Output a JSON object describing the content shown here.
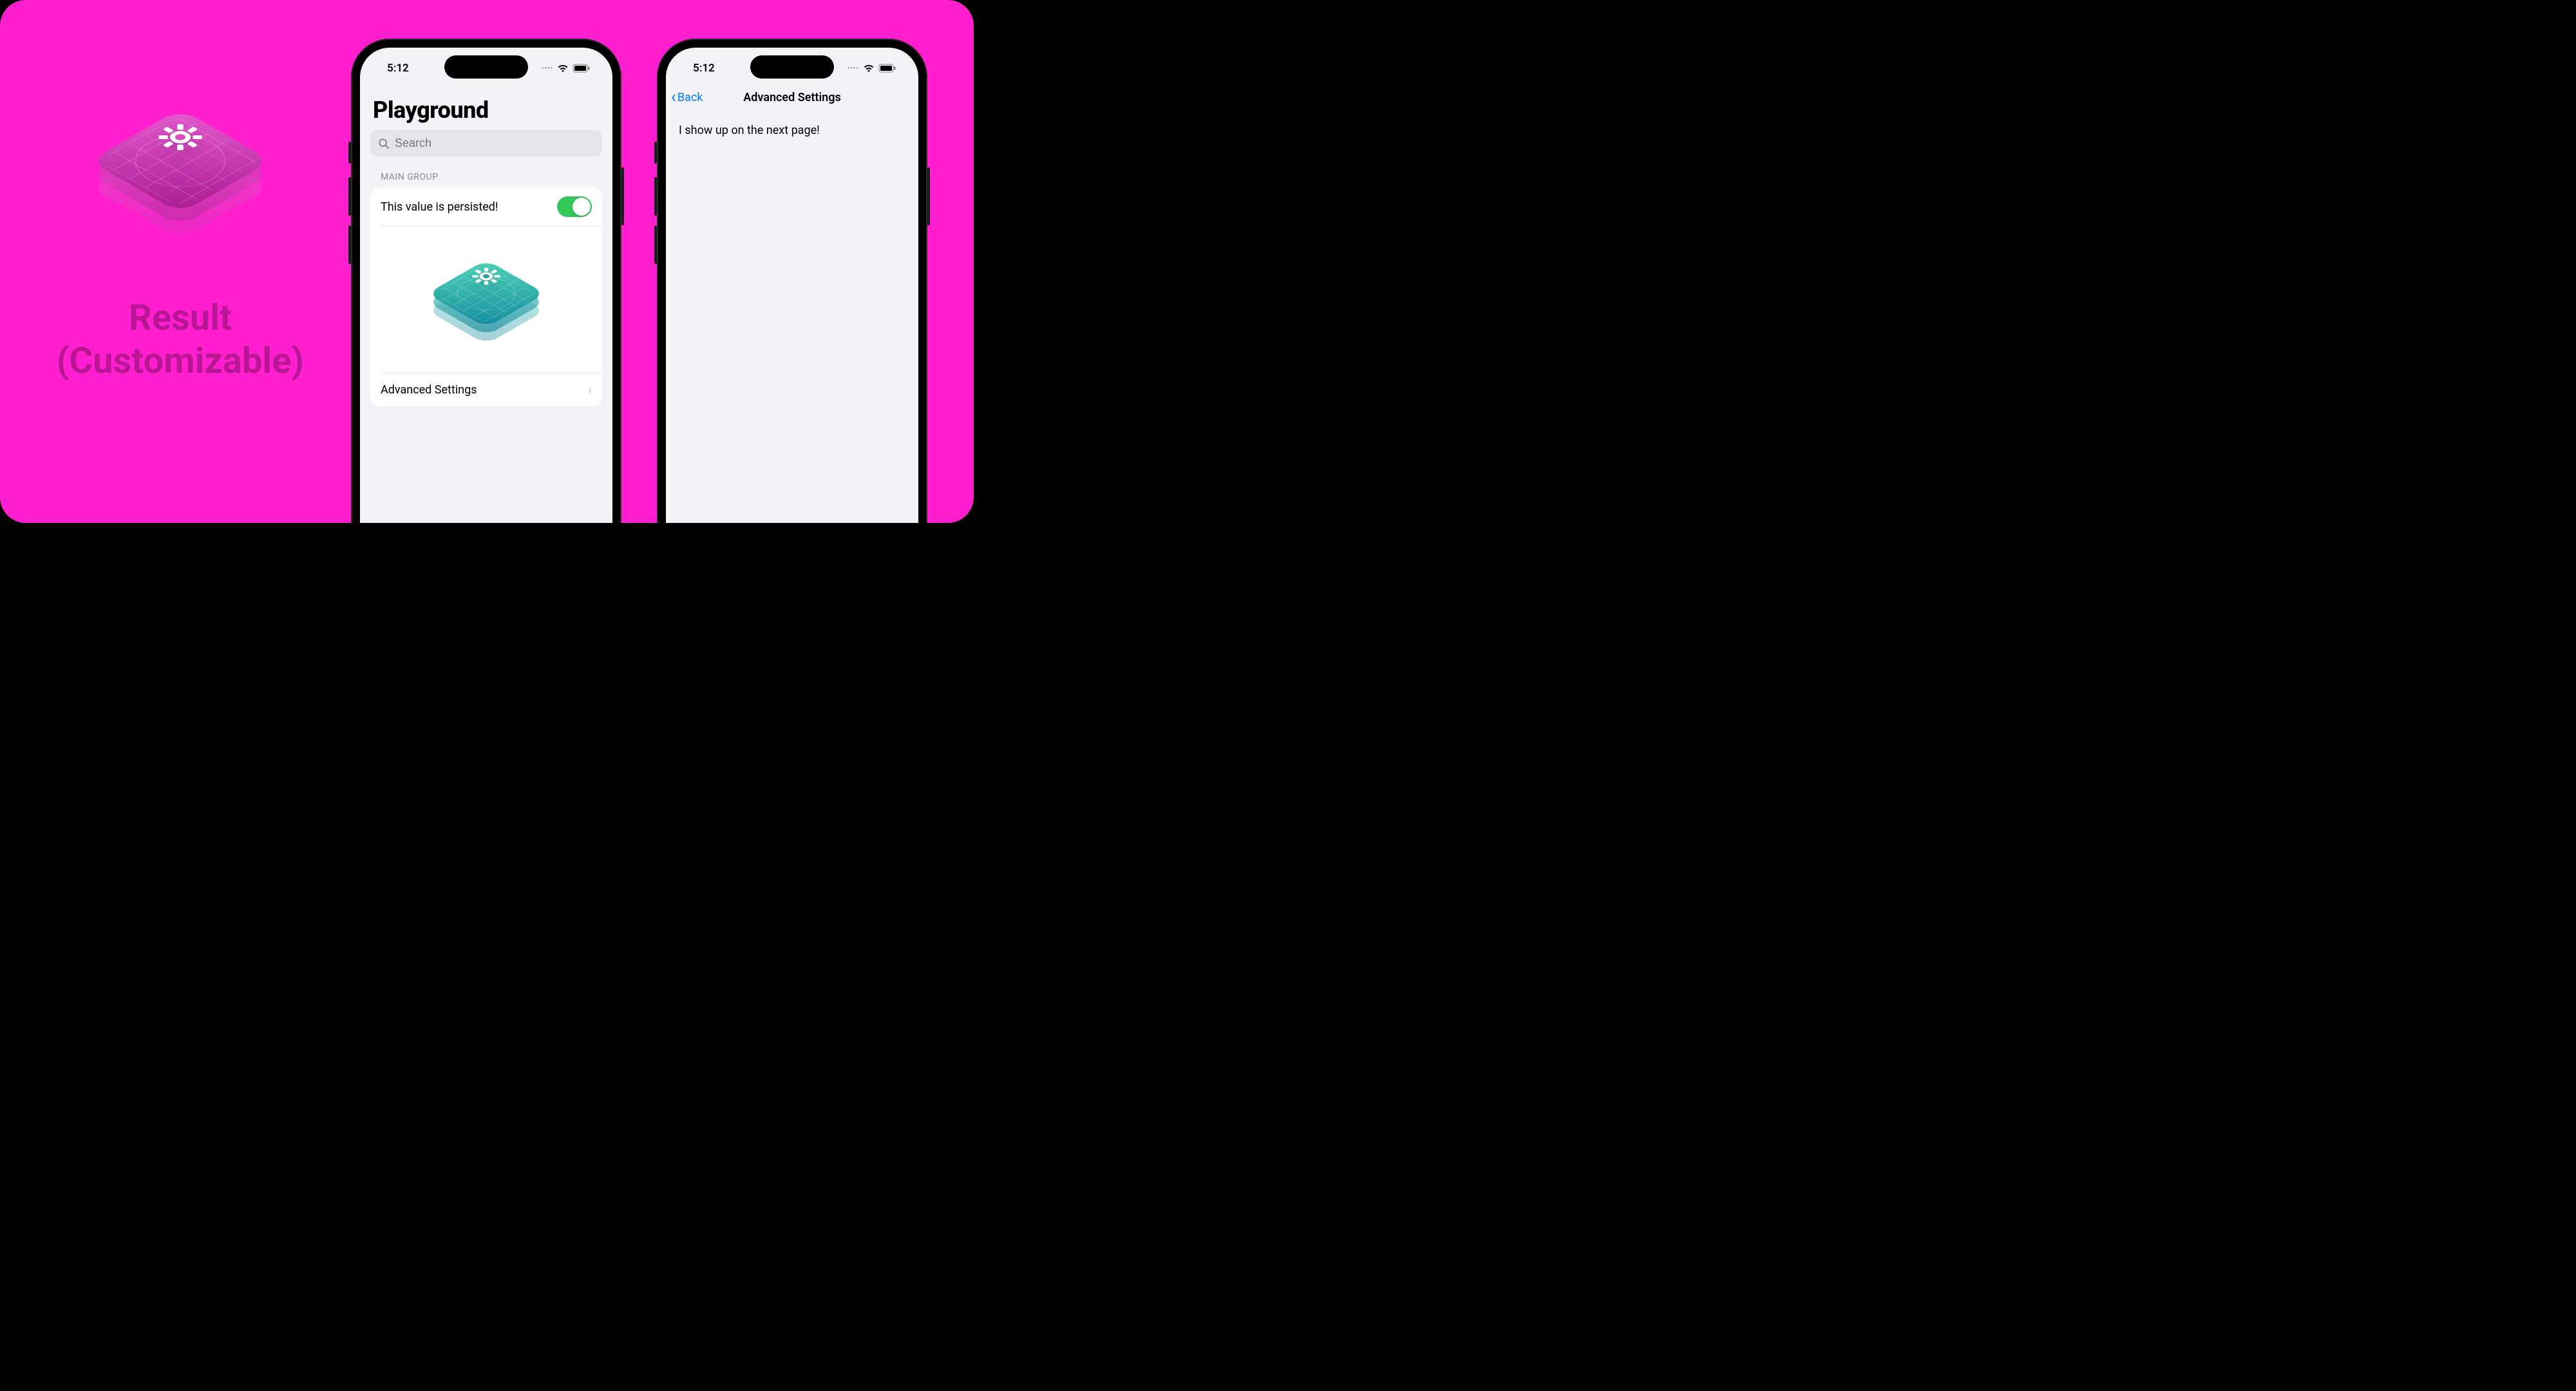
{
  "promo": {
    "line1": "Result",
    "line2": "(Customizable)"
  },
  "status": {
    "time": "5:12"
  },
  "phone1": {
    "title": "Playground",
    "search_placeholder": "Search",
    "section_header": "MAIN GROUP",
    "toggle_label": "This value is persisted!",
    "toggle_on": true,
    "advanced_label": "Advanced Settings"
  },
  "phone2": {
    "back_label": "Back",
    "nav_title": "Advanced Settings",
    "body_text": "I show up on the next page!"
  },
  "colors": {
    "accent_green": "#34c759",
    "ios_blue": "#007aff",
    "bg_magenta": "#ff1fce"
  }
}
